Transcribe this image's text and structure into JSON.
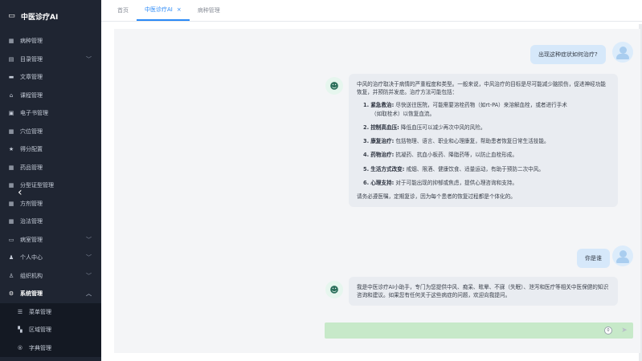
{
  "brand": {
    "title": "中医诊疗AI"
  },
  "sidebar": {
    "items": [
      {
        "label": "病种管理",
        "icon": "grid-icon",
        "glyph": "▦",
        "chevron": false
      },
      {
        "label": "目录管理",
        "icon": "category-icon",
        "glyph": "▤",
        "chevron": true
      },
      {
        "label": "文章管理",
        "icon": "monitor-icon",
        "glyph": "▬",
        "chevron": false
      },
      {
        "label": "课程管理",
        "icon": "home-icon",
        "glyph": "⌂",
        "chevron": false
      },
      {
        "label": "电子书管理",
        "icon": "book-icon",
        "glyph": "▣",
        "chevron": false
      },
      {
        "label": "穴位管理",
        "icon": "grid-icon",
        "glyph": "▦",
        "chevron": false
      },
      {
        "label": "得分配置",
        "icon": "star-icon",
        "glyph": "★",
        "chevron": false
      },
      {
        "label": "药品管理",
        "icon": "grid-icon",
        "glyph": "▦",
        "chevron": false
      },
      {
        "label": "分型证型管理",
        "icon": "grid-icon",
        "glyph": "▦",
        "chevron": false
      },
      {
        "label": "方剂管理",
        "icon": "grid-icon",
        "glyph": "▦",
        "chevron": false
      },
      {
        "label": "治法管理",
        "icon": "grid-icon",
        "glyph": "▦",
        "chevron": false
      },
      {
        "label": "病室管理",
        "icon": "bed-icon",
        "glyph": "▭",
        "chevron": true
      },
      {
        "label": "个人中心",
        "icon": "user-icon",
        "glyph": "♟",
        "chevron": true
      },
      {
        "label": "组织机构",
        "icon": "org-icon",
        "glyph": "♙",
        "chevron": true
      },
      {
        "label": "系统管理",
        "icon": "gears-icon",
        "glyph": "⚙",
        "chevron": true,
        "active": true
      },
      {
        "label": "菜单管理",
        "icon": "list-icon",
        "glyph": "☰",
        "chevron": false,
        "sub": true
      },
      {
        "label": "区域管理",
        "icon": "map-icon",
        "glyph": "▚",
        "chevron": false,
        "sub": true
      },
      {
        "label": "字典管理",
        "icon": "dict-icon",
        "glyph": "®",
        "chevron": false,
        "sub": true
      }
    ]
  },
  "tabs": [
    {
      "label": "首页",
      "active": false
    },
    {
      "label": "中医诊疗AI",
      "active": true,
      "close": "×"
    },
    {
      "label": "病种管理",
      "active": false
    }
  ],
  "chat": {
    "msg1_user": "出现这种症状如何治疗?",
    "msg1_bot": {
      "intro": "中风的治疗取决于病情的严重程度和类型。一般来说，中风治疗的目标是尽可能减少脑损伤，促进神经功能恢复，并预防并发症。治疗方法可能包括：",
      "items": [
        {
          "num": "1.",
          "title": "紧急救治:",
          "text": "尽快送往医院，可能需要溶栓药物（如rt-PA）来溶解血栓，或者进行手术",
          "text2": "（如取栓术）以恢复血流。"
        },
        {
          "num": "2.",
          "title": "控制高血压:",
          "text": "降低血压可以减少再次中风的风险。"
        },
        {
          "num": "3.",
          "title": "康复治疗:",
          "text": "包括物理、语言、职业和心理康复，帮助患者恢复日常生活技能。"
        },
        {
          "num": "4.",
          "title": "药物治疗:",
          "text": "抗凝药、抗血小板药、降脂药等，以防止血栓形成。"
        },
        {
          "num": "5.",
          "title": "生活方式改变:",
          "text": "戒烟、限酒、健康饮食、适量运动，有助于预防二次中风。"
        },
        {
          "num": "6.",
          "title": "心理支持:",
          "text": "对于可能出现的抑郁或焦虑，提供心理咨询和支持。"
        }
      ],
      "outro": "请务必遵医嘱，定期复诊，因为每个患者的恢复过程都是个体化的。"
    },
    "msg2_user": "你是谁",
    "msg2_bot": "我是中医诊疗AI小助手，专门为您提供中风、痴呆、眩晕、不寐（失眠）、泄泻和医疗等相关中医保健的知识咨询和建议。如果您有任何关于这些病症的问题，欢迎向我提问。"
  },
  "input": {
    "value": "",
    "counter": "0",
    "send_icon": "➤"
  },
  "colors": {
    "sidebar_bg": "#1f2532",
    "accent": "#2b8af7",
    "input_bg": "#c7e9c9"
  }
}
